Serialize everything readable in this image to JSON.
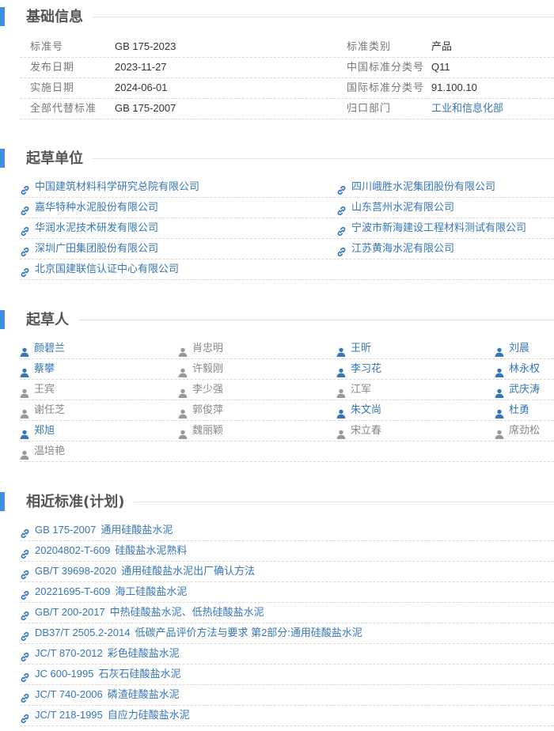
{
  "basic": {
    "title": "基础信息",
    "left": [
      {
        "label": "标准号",
        "value": "GB 175-2023"
      },
      {
        "label": "发布日期",
        "value": "2023-11-27"
      },
      {
        "label": "实施日期",
        "value": "2024-06-01"
      },
      {
        "label": "全部代替标准",
        "value": "GB 175-2007"
      }
    ],
    "right": [
      {
        "label": "标准类别",
        "value": "产品"
      },
      {
        "label": "中国标准分类号",
        "value": "Q11"
      },
      {
        "label": "国际标准分类号",
        "value": "91.100.10"
      },
      {
        "label": "归口部门",
        "value": "工业和信息化部"
      }
    ]
  },
  "drafting_units": {
    "title": "起草单位",
    "items": [
      "中国建筑材料科学研究总院有限公司",
      "四川峨胜水泥集团股份有限公司",
      "嘉华特种水泥股份有限公司",
      "山东莒州水泥有限公司",
      "华润水泥技术研发有限公司",
      "宁波市新海建设工程材料测试有限公司",
      "深圳广田集团股份有限公司",
      "江苏黄海水泥有限公司",
      "北京国建联信认证中心有限公司"
    ]
  },
  "drafters": {
    "title": "起草人",
    "items": [
      {
        "name": "颜碧兰",
        "linked": true
      },
      {
        "name": "肖忠明",
        "linked": false
      },
      {
        "name": "王昕",
        "linked": true
      },
      {
        "name": "刘晨",
        "linked": true
      },
      {
        "name": "蔡攀",
        "linked": true
      },
      {
        "name": "许毅刚",
        "linked": false
      },
      {
        "name": "李习花",
        "linked": true
      },
      {
        "name": "林永权",
        "linked": true
      },
      {
        "name": "王宾",
        "linked": false
      },
      {
        "name": "李少强",
        "linked": false
      },
      {
        "name": "江军",
        "linked": false
      },
      {
        "name": "武庆涛",
        "linked": true
      },
      {
        "name": "谢任芝",
        "linked": false
      },
      {
        "name": "郭俊萍",
        "linked": false
      },
      {
        "name": "朱文尚",
        "linked": true
      },
      {
        "name": "杜勇",
        "linked": true
      },
      {
        "name": "郑旭",
        "linked": true
      },
      {
        "name": "魏丽颖",
        "linked": false
      },
      {
        "name": "宋立春",
        "linked": false
      },
      {
        "name": "席劲松",
        "linked": false
      },
      {
        "name": "温培艳",
        "linked": false
      }
    ]
  },
  "related": {
    "title": "相近标准(计划)",
    "items": [
      {
        "code": "GB 175-2007",
        "title": "通用硅酸盐水泥"
      },
      {
        "code": "20204802-T-609",
        "title": "硅酸盐水泥熟料"
      },
      {
        "code": "GB/T 39698-2020",
        "title": "通用硅酸盐水泥出厂确认方法"
      },
      {
        "code": "20221695-T-609",
        "title": "海工硅酸盐水泥"
      },
      {
        "code": "GB/T 200-2017",
        "title": "中热硅酸盐水泥、低热硅酸盐水泥"
      },
      {
        "code": "DB37/T 2505.2-2014",
        "title": "低碳产品评价方法与要求 第2部分:通用硅酸盐水泥"
      },
      {
        "code": "JC/T 870-2012",
        "title": "彩色硅酸盐水泥"
      },
      {
        "code": "JC 600-1995",
        "title": "石灰石硅酸盐水泥"
      },
      {
        "code": "JC/T 740-2006",
        "title": "磷渣硅酸盐水泥"
      },
      {
        "code": "JC/T 218-1995",
        "title": "自应力硅酸盐水泥"
      }
    ]
  },
  "colors": {
    "accent": "#3f8ee3",
    "link": "#3577b9",
    "muted": "#888888"
  },
  "icons": {
    "org": "chain-link-icon",
    "person": "person-icon",
    "standard": "chain-link-icon"
  }
}
